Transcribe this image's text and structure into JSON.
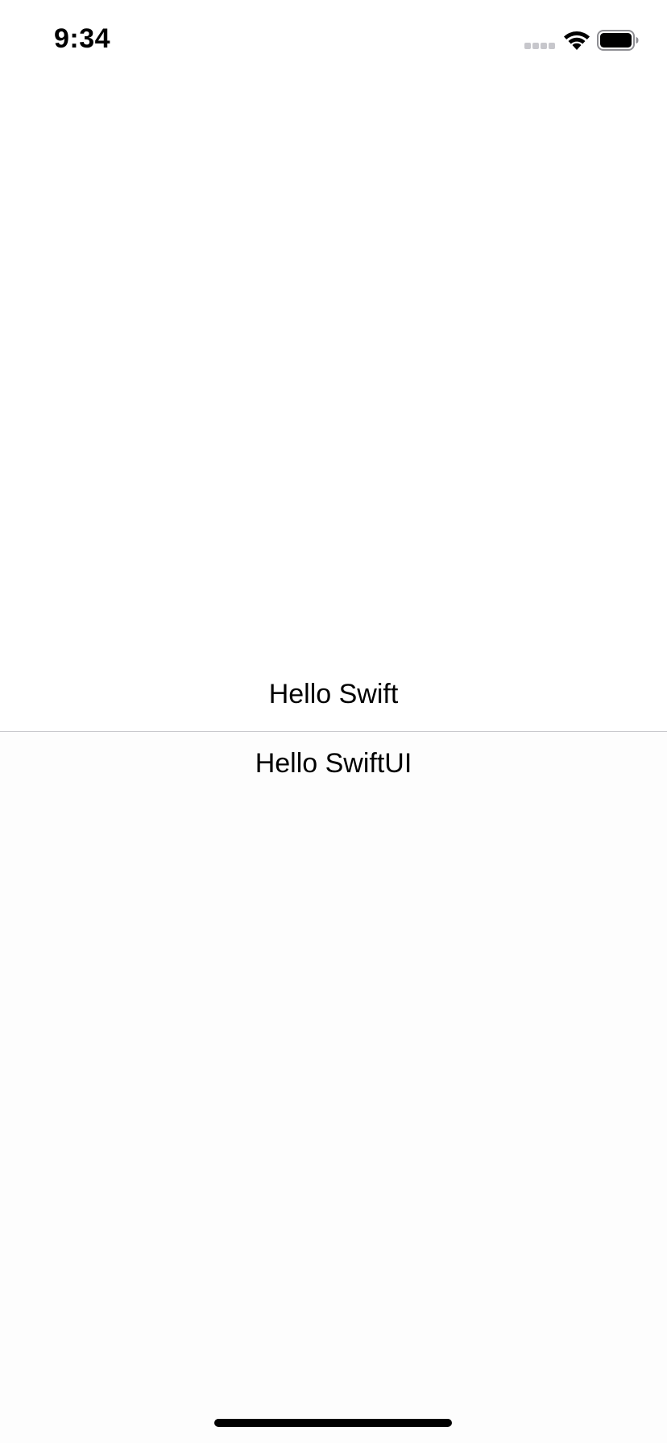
{
  "status_bar": {
    "time": "9:34",
    "signal_icon": "cellular-signal-icon",
    "wifi_icon": "wifi-icon",
    "battery_icon": "battery-icon"
  },
  "content": {
    "top_text": "Hello Swift",
    "bottom_text": "Hello SwiftUI"
  },
  "colors": {
    "text": "#000000",
    "background": "#ffffff",
    "divider": "#c8c8cc"
  }
}
